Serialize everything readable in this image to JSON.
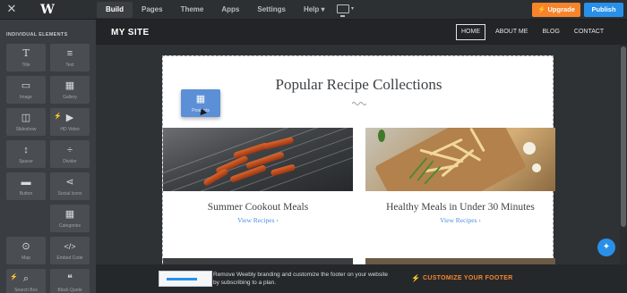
{
  "topbar": {
    "nav": [
      "Build",
      "Pages",
      "Theme",
      "Apps",
      "Settings",
      "Help"
    ],
    "help_caret": "▾",
    "upgrade_label": "Upgrade",
    "publish_label": "Publish",
    "accent_orange": "#f7842b",
    "accent_blue": "#2990ea"
  },
  "sidebar": {
    "heading": "INDIVIDUAL ELEMENTS",
    "tiles": [
      {
        "label": "Title",
        "icon": "title-icon",
        "glyph": "T"
      },
      {
        "label": "Text",
        "icon": "text-icon",
        "glyph": "≡"
      },
      {
        "label": "Image",
        "icon": "image-icon",
        "glyph": "▭"
      },
      {
        "label": "Gallery",
        "icon": "gallery-icon",
        "glyph": "▦"
      },
      {
        "label": "Slideshow",
        "icon": "slideshow-icon",
        "glyph": "◫"
      },
      {
        "label": "HD Video",
        "icon": "video-icon",
        "glyph": "▶"
      },
      {
        "label": "Spacer",
        "icon": "spacer-icon",
        "glyph": "↕"
      },
      {
        "label": "Divider",
        "icon": "divider-icon",
        "glyph": "÷"
      },
      {
        "label": "Button",
        "icon": "button-icon",
        "glyph": "▬"
      },
      {
        "label": "Social Icons",
        "icon": "share-icon",
        "glyph": "⋖"
      },
      {
        "label": "Categories",
        "icon": "categories-icon",
        "glyph": "▦"
      },
      {
        "label": "Map",
        "icon": "map-pin-icon",
        "glyph": "⊙"
      },
      {
        "label": "Embed Code",
        "icon": "code-icon",
        "glyph": "</>"
      },
      {
        "label": "Search Box",
        "icon": "search-icon",
        "glyph": "⌕"
      },
      {
        "label": "Block Quote",
        "icon": "quote-icon",
        "glyph": "❝"
      }
    ]
  },
  "site": {
    "title": "MY SITE",
    "nav": [
      "HOME",
      "ABOUT ME",
      "BLOG",
      "CONTACT"
    ],
    "section_title": "Popular Recipe Collections",
    "drag_label": "Products",
    "cards": [
      {
        "title": "Summer Cookout Meals",
        "link": "View Recipes ›"
      },
      {
        "title": "Healthy Meals in Under 30 Minutes",
        "link": "View Recipes ›"
      }
    ]
  },
  "footer": {
    "text": "Remove Weebly branding and customize the footer on your website by subscribing to a plan.",
    "cta": "CUSTOMIZE YOUR FOOTER"
  }
}
